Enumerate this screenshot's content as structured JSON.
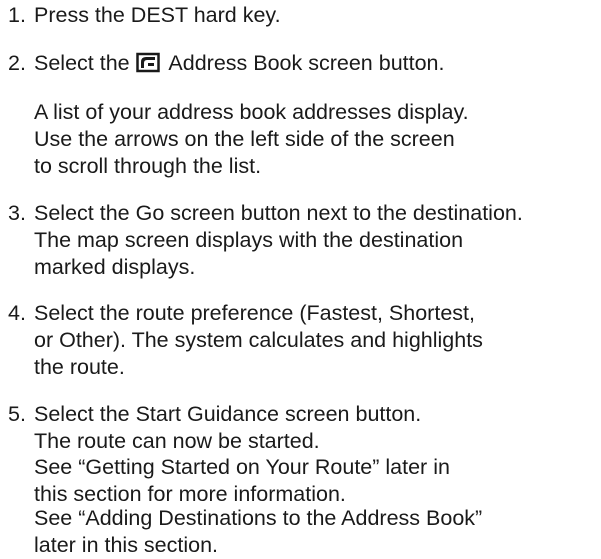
{
  "steps": [
    {
      "number": "1.",
      "lines": [
        "Press the DEST hard key."
      ]
    },
    {
      "number": "2.",
      "before_icon": "Select the",
      "after_icon": "Address Book screen button.",
      "icon": "address-book-icon"
    },
    {
      "number": "3.",
      "lines": [
        "Select the Go screen button next to the destination.",
        "The map screen displays with the destination",
        "marked displays."
      ]
    },
    {
      "number": "4.",
      "lines": [
        "Select the route preference (Fastest, Shortest,",
        "or Other). The system calculates and highlights",
        "the route."
      ]
    },
    {
      "number": "5.",
      "lines": [
        "Select the Start Guidance screen button.",
        "The route can now be started."
      ]
    }
  ],
  "notes": {
    "address_book_list": [
      "A list of your address book addresses display.",
      "Use the arrows on the left side of the screen",
      "to scroll through the list."
    ],
    "getting_started": [
      "See “Getting Started on Your Route” later in",
      "this section for more information."
    ],
    "adding_destinations": [
      "See “Adding Destinations to the Address Book”",
      "later in this section."
    ]
  }
}
